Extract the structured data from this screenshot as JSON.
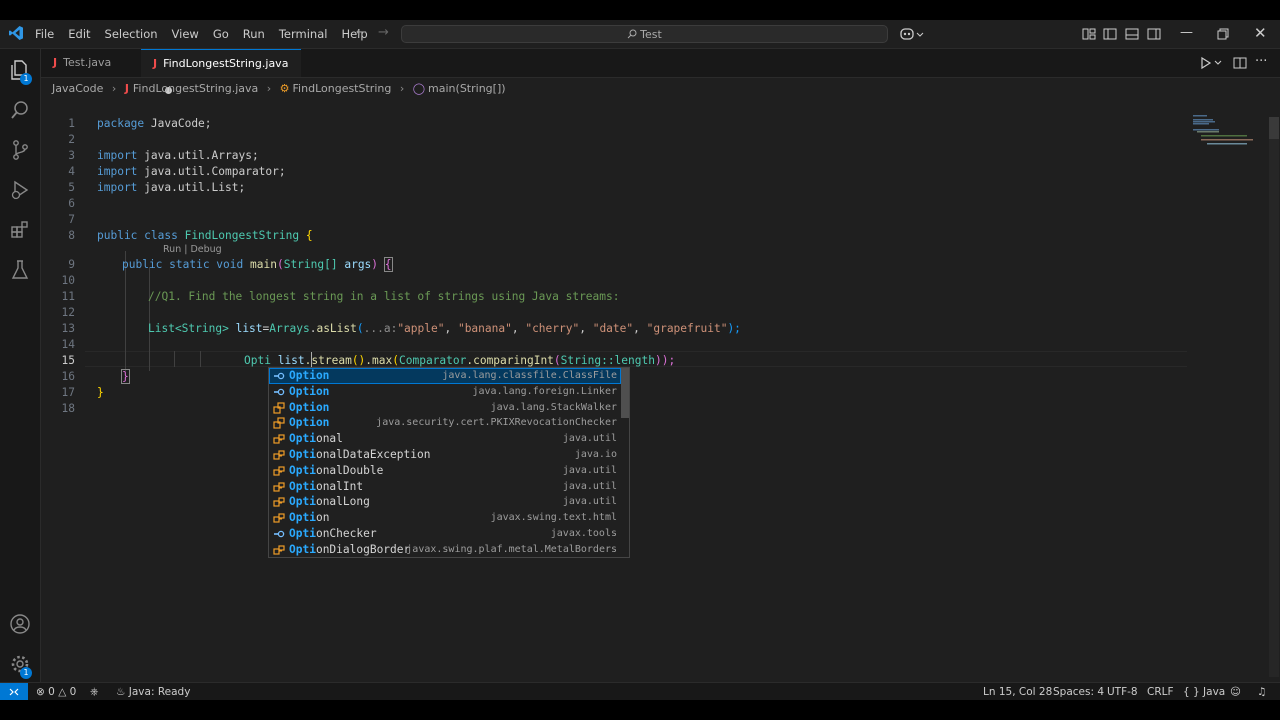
{
  "titlebar": {
    "menu": [
      "File",
      "Edit",
      "Selection",
      "View",
      "Go",
      "Run",
      "Terminal",
      "Help"
    ],
    "search_text": "Test"
  },
  "activity_badges": {
    "explorer": "1",
    "manage": "1"
  },
  "tabs": [
    {
      "label": "Test.java"
    },
    {
      "label": "FindLongestString.java"
    }
  ],
  "breadcrumb": {
    "folder": "JavaCode",
    "file": "FindLongestString.java",
    "class_name": "FindLongestString",
    "method": "main(String[])"
  },
  "editor": {
    "line_numbers": [
      "1",
      "2",
      "3",
      "4",
      "5",
      "6",
      "7",
      "8",
      "9",
      "10",
      "11",
      "12",
      "13",
      "14",
      "15",
      "16",
      "17",
      "18"
    ],
    "codelens": "Run | Debug",
    "code": {
      "l1_kw": "package",
      "l1_name": "JavaCode;",
      "l3_kw": "import",
      "l3_name": "java.util.Arrays;",
      "l4_kw": "import",
      "l4_name": "java.util.Comparator;",
      "l5_kw": "import",
      "l5_name": "java.util.List;",
      "l8_kw": "public class",
      "l8_name": "FindLongestString",
      "l8_brace": "{",
      "l9_kw": "public static void",
      "l9_fn": "main",
      "l9_paren_open": "(",
      "l9_type": "String[]",
      "l9_arg": "args",
      "l9_paren_close": ")",
      "l9_brace": "{",
      "l11_comment": "//Q1. Find the longest string in a list of strings using Java streams:",
      "l13_type": "List<String>",
      "l13_var": "list",
      "l13_eq": "=",
      "l13_cls": "Arrays",
      "l13_dot": ".",
      "l13_fn": "asList",
      "l13_open": "(",
      "l13_hint": "...a:",
      "l13_s1": "\"apple\"",
      "l13_s2": "\"banana\"",
      "l13_s3": "\"cherry\"",
      "l13_s4": "\"date\"",
      "l13_s5": "\"grapefruit\"",
      "l13_close": ");",
      "l15_typed": "Opti",
      "l15_var": "list",
      "l15_stream": ".stream",
      "l15_p1": "()",
      "l15_max": ".max",
      "l15_p2": "(",
      "l15_cmp": "Comparator",
      "l15_cmpfn": ".comparingInt",
      "l15_p3": "(",
      "l15_ref": "String::length",
      "l15_end": "));",
      "l16_brace": "}",
      "l17_brace": "}"
    }
  },
  "suggestions": [
    {
      "match": "Option",
      "rest": "",
      "detail": "java.lang.classfile.ClassFile",
      "icon": "field-icon",
      "selected": true
    },
    {
      "match": "Option",
      "rest": "",
      "detail": "java.lang.foreign.Linker",
      "icon": "field-icon"
    },
    {
      "match": "Option",
      "rest": "",
      "detail": "java.lang.StackWalker",
      "icon": "enum-icon"
    },
    {
      "match": "Option",
      "rest": "",
      "detail": "java.security.cert.PKIXRevocationChecker",
      "icon": "enum-icon"
    },
    {
      "match": "Opti",
      "rest": "onal",
      "detail": "java.util",
      "icon": "class-icon"
    },
    {
      "match": "Opti",
      "rest": "onalDataException",
      "detail": "java.io",
      "icon": "class-icon"
    },
    {
      "match": "Opti",
      "rest": "onalDouble",
      "detail": "java.util",
      "icon": "class-icon"
    },
    {
      "match": "Opti",
      "rest": "onalInt",
      "detail": "java.util",
      "icon": "class-icon"
    },
    {
      "match": "Opti",
      "rest": "onalLong",
      "detail": "java.util",
      "icon": "class-icon"
    },
    {
      "match": "Opti",
      "rest": "on",
      "detail": "javax.swing.text.html",
      "icon": "class-icon"
    },
    {
      "match": "Opti",
      "rest": "onChecker",
      "detail": "javax.tools",
      "icon": "field-icon"
    },
    {
      "match": "Opti",
      "rest": "onDialogBorder",
      "detail": "javax.swing.plaf.metal.MetalBorders",
      "icon": "class-icon"
    }
  ],
  "statusbar": {
    "errors": "0",
    "warnings": "0",
    "java_status": "Java: Ready",
    "position": "Ln 15, Col 28",
    "spaces": "Spaces: 4",
    "encoding": "UTF-8",
    "eol": "CRLF",
    "language": "Java"
  },
  "colors": {
    "accent": "#0078d4",
    "keyword": "#569cd6",
    "type": "#4ec9b0",
    "string": "#ce9178",
    "comment": "#6a9955",
    "function": "#dcdcaa",
    "suggest_match": "#2aaaff"
  }
}
